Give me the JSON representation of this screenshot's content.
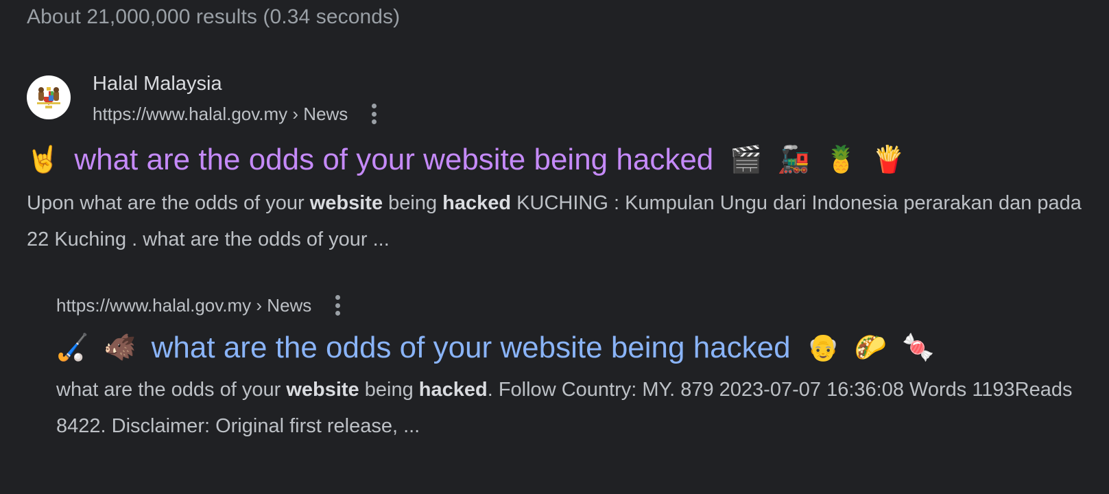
{
  "search_stats": "About 21,000,000 results (0.34 seconds)",
  "results": [
    {
      "site_name": "Halal Malaysia",
      "favicon": "malaysia-coat-of-arms-icon",
      "url": "https://www.halal.gov.my › News",
      "more_icon": "three-dots-vertical-icon",
      "title_prefix_emojis": [
        "🤘"
      ],
      "title": "what are the odds of your website being hacked",
      "title_suffix_emojis": [
        "🎬",
        "🚂",
        "🍍",
        "🍟"
      ],
      "title_color": "#c58af9",
      "snippet_parts": [
        {
          "text": "Upon what are the odds of your ",
          "bold": false
        },
        {
          "text": "website",
          "bold": true
        },
        {
          "text": " being ",
          "bold": false
        },
        {
          "text": "hacked",
          "bold": true
        },
        {
          "text": " KUCHING : Kumpulan Ungu dari Indonesia perarakan dan pada 22 Kuching . what are the odds of your ...",
          "bold": false
        }
      ]
    },
    {
      "url": "https://www.halal.gov.my › News",
      "more_icon": "three-dots-vertical-icon",
      "title_prefix_emojis": [
        "🏑",
        "🐗"
      ],
      "title": "what are the odds of your website being hacked",
      "title_suffix_emojis": [
        "👴",
        "🌮",
        "🍬"
      ],
      "title_color": "#8ab4f8",
      "snippet_parts": [
        {
          "text": "what are the odds of your ",
          "bold": false
        },
        {
          "text": "website",
          "bold": true
        },
        {
          "text": " being ",
          "bold": false
        },
        {
          "text": "hacked",
          "bold": true
        },
        {
          "text": ". Follow Country: MY. 879 2023-07-07 16:36:08 Words 1193Reads 8422. Disclaimer: Original first release, ...",
          "bold": false
        }
      ]
    }
  ],
  "colors": {
    "background": "#202124",
    "visited_link": "#c58af9",
    "link": "#8ab4f8",
    "text": "#bdc1c6",
    "stats_text": "#9aa0a6"
  }
}
